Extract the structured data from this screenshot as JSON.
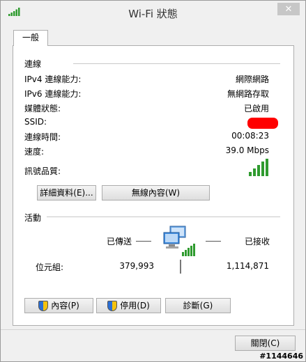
{
  "window": {
    "title": "Wi-Fi 狀態",
    "close_glyph": "✕"
  },
  "tabs": [
    {
      "label": "一般"
    }
  ],
  "connection": {
    "section_title": "連線",
    "rows": [
      {
        "label": "IPv4 連線能力:",
        "value": "網際網路"
      },
      {
        "label": "IPv6 連線能力:",
        "value": "無網路存取"
      },
      {
        "label": "媒體狀態:",
        "value": "已啟用"
      },
      {
        "label": "SSID:",
        "value": ""
      },
      {
        "label": "連線時間:",
        "value": "00:08:23"
      },
      {
        "label": "速度:",
        "value": "39.0 Mbps"
      },
      {
        "label": "訊號品質:",
        "value": ""
      }
    ],
    "signal_strength": 1.0,
    "details_button": "詳細資料(E)...",
    "wireless_props_button": "無線內容(W)"
  },
  "activity": {
    "section_title": "活動",
    "sent_label": "已傳送",
    "received_label": "已接收",
    "bytes_label": "位元組:",
    "bytes_sent": "379,993",
    "bytes_received": "1,114,871",
    "network_icon": "network-computer-icon"
  },
  "buttons": {
    "properties": "內容(P)",
    "disable": "停用(D)",
    "diagnose": "診斷(G)",
    "close": "關閉(C)"
  },
  "watermark": "#1144646",
  "colors": {
    "signal_green": "#2f9b2f",
    "redaction": "#ff0000"
  }
}
